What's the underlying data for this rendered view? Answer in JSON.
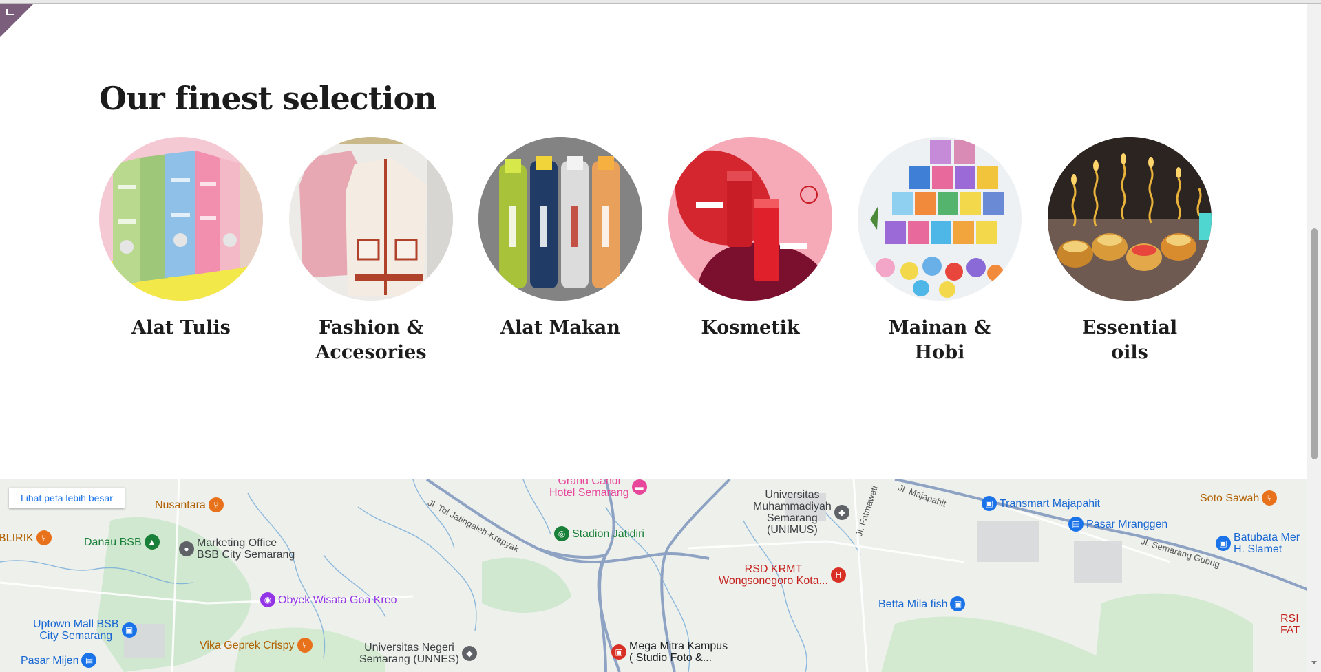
{
  "section": {
    "title": "Our finest selection"
  },
  "categories": [
    {
      "label": "Alat Tulis",
      "icon": "pen-holders-photo"
    },
    {
      "label": "Fashion & Accesories",
      "icon": "cardigans-photo"
    },
    {
      "label": "Alat Makan",
      "icon": "bottles-photo"
    },
    {
      "label": "Kosmetik",
      "icon": "lip-tint-photo"
    },
    {
      "label": "Mainan & Hobi",
      "icon": "brick-figures-photo"
    },
    {
      "label": "Essential oils",
      "icon": "candles-photo"
    }
  ],
  "map": {
    "enlarge_label": "Lihat peta lebih besar",
    "places": [
      {
        "name": "Grand Candi Hotel Semarang",
        "line1": "Grand Candi",
        "line2": "Hotel Semarang",
        "color": "#e8469b"
      },
      {
        "name": "Nusantara",
        "color": "#e8711c"
      },
      {
        "name": "BLIRIK",
        "color": "#e8711c"
      },
      {
        "name": "Danau BSB",
        "color": "#188038"
      },
      {
        "name": "Marketing Office BSB City Semarang",
        "line1": "Marketing Office",
        "line2": "BSB City Semarang",
        "color": "#5f6368"
      },
      {
        "name": "Obyek Wisata Goa Kreo",
        "color": "#9334e6"
      },
      {
        "name": "Uptown Mall BSB City Semarang",
        "line1": "Uptown Mall BSB",
        "line2": "City Semarang",
        "color": "#1a73e8"
      },
      {
        "name": "Vika Geprek Crispy",
        "color": "#e8711c"
      },
      {
        "name": "Pasar Mijen",
        "color": "#1a73e8"
      },
      {
        "name": "Universitas Negeri Semarang (UNNES)",
        "line1": "Universitas Negeri",
        "line2": "Semarang (UNNES)",
        "color": "#5f6368"
      },
      {
        "name": "Stadion Jatidiri",
        "color": "#188038"
      },
      {
        "name": "Universitas Muhammadiyah Semarang (UNIMUS)",
        "line1": "Universitas",
        "line2": "Muhammadiyah",
        "line3": "Semarang",
        "line4": "(UNIMUS)",
        "color": "#5f6368"
      },
      {
        "name": "RSD KRMT Wongsonegoro Kota...",
        "line1": "RSD KRMT",
        "line2": "Wongsonegoro Kota...",
        "color": "#d93025"
      },
      {
        "name": "Mega Mitra Kampus ( Studio Foto &...",
        "line1": "Mega Mitra Kampus",
        "line2": "( Studio Foto &...",
        "color": "#d93025"
      },
      {
        "name": "Betta Mila fish",
        "color": "#1a73e8"
      },
      {
        "name": "Transmart Majapahit",
        "color": "#1a73e8"
      },
      {
        "name": "Pasar Mranggen",
        "color": "#1a73e8"
      },
      {
        "name": "Soto Sawah",
        "color": "#e8711c"
      },
      {
        "name": "Batubata Merah H. Slamet",
        "line1": "Batubata Mer",
        "line2": "H. Slamet",
        "color": "#1a73e8"
      },
      {
        "name": "RSI FAT",
        "line1": "RSI",
        "line2": "FAT",
        "color": "#d93025"
      }
    ],
    "roads": [
      {
        "name": "Jl. Tol Jatingaleh-Krapyak"
      },
      {
        "name": "Jl. Fatmawati"
      },
      {
        "name": "Jl. Majapahit"
      },
      {
        "name": "Jl. Semarang Gubug"
      }
    ]
  }
}
